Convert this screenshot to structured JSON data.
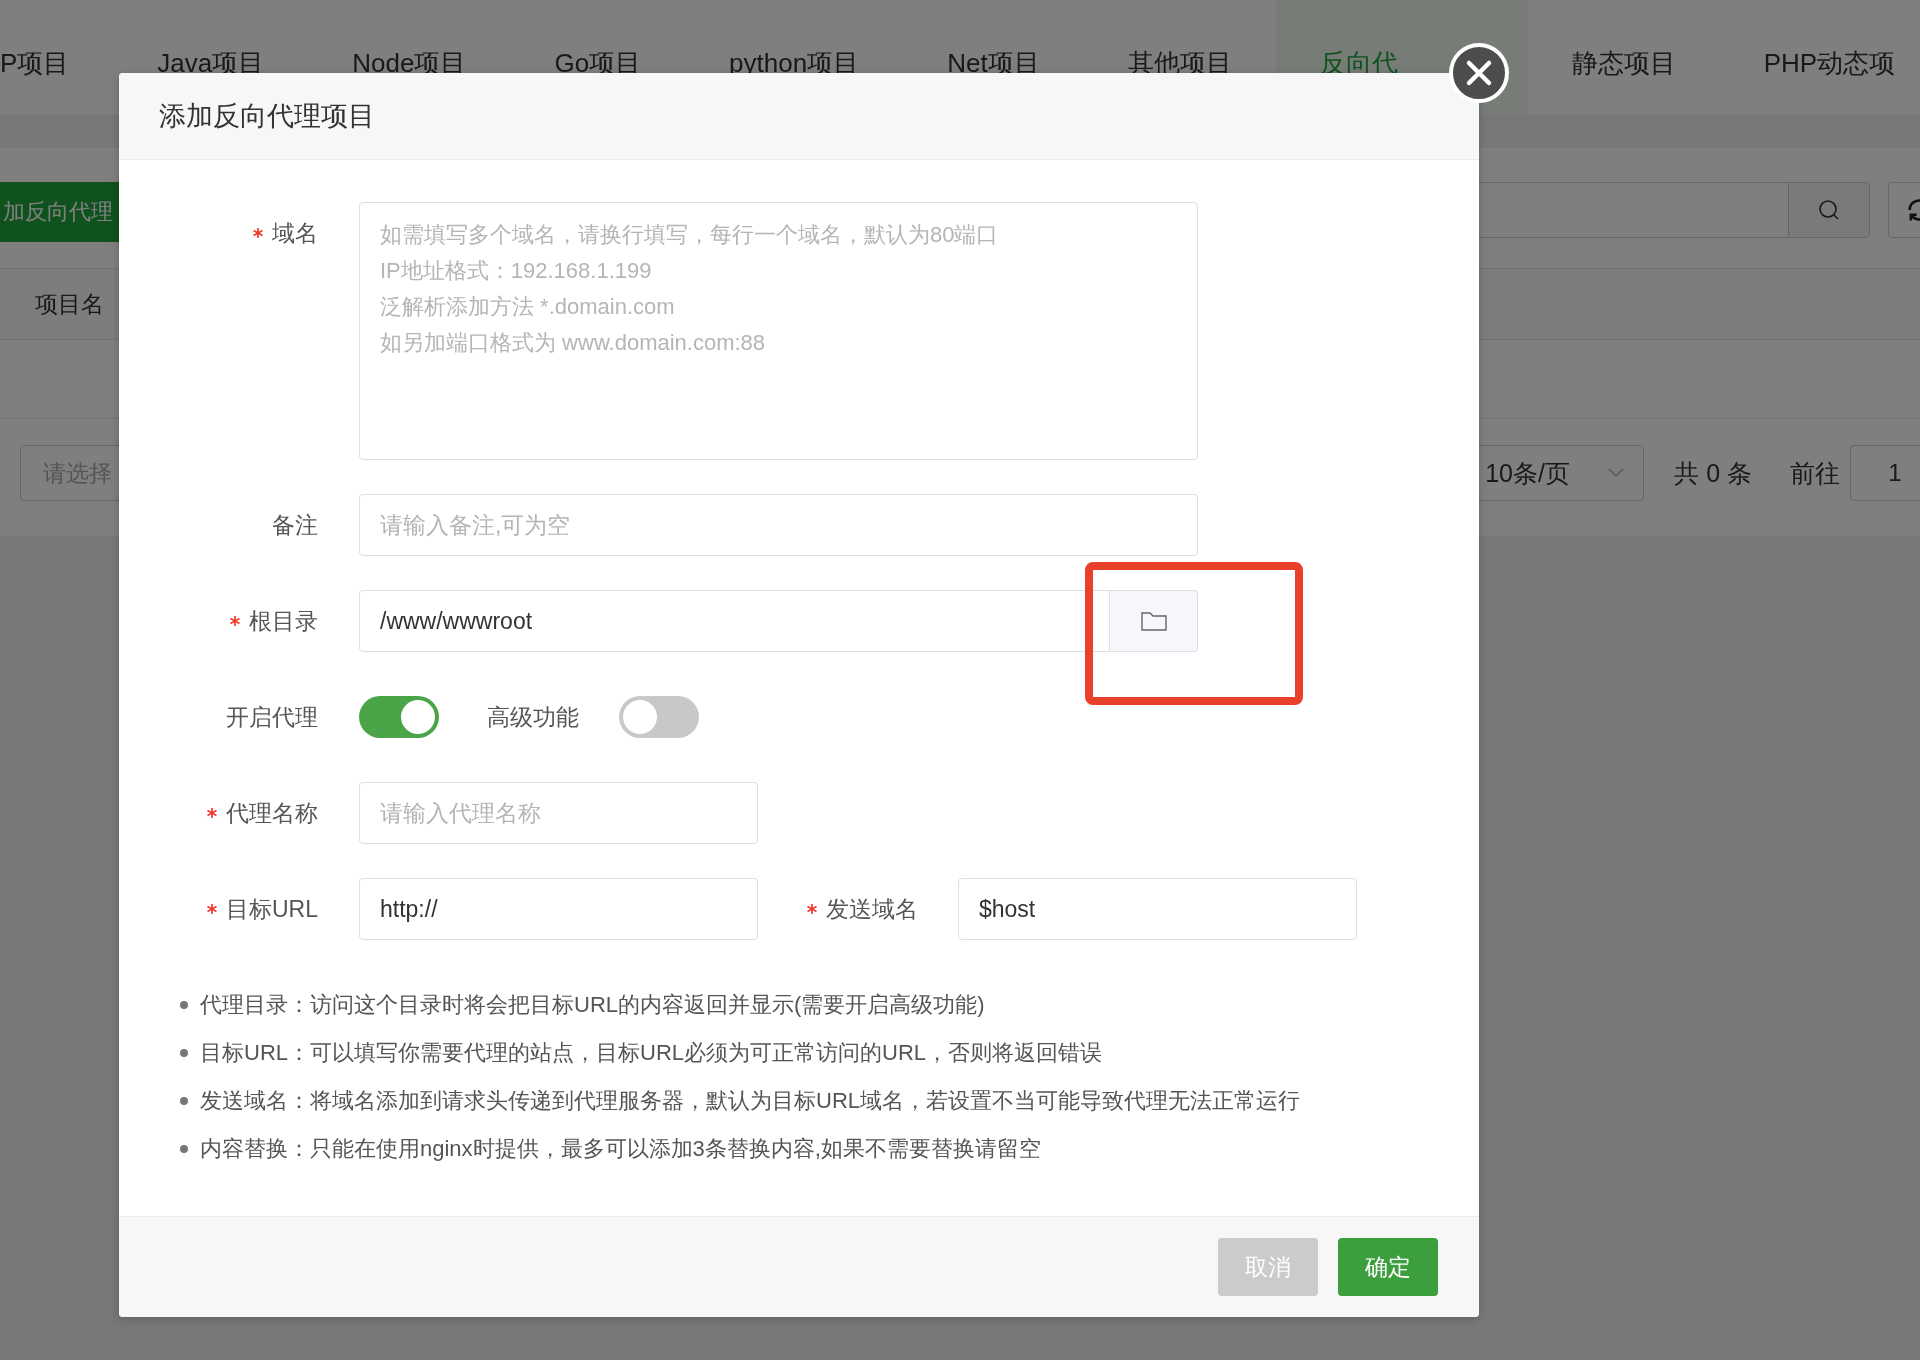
{
  "tabs": [
    {
      "label": "P项目",
      "selected": false
    },
    {
      "label": "Java项目",
      "selected": false
    },
    {
      "label": "Node项目",
      "selected": false
    },
    {
      "label": "Go项目",
      "selected": false
    },
    {
      "label": "python项目",
      "selected": false
    },
    {
      "label": "Net项目",
      "selected": false
    },
    {
      "label": "其他项目",
      "selected": false
    },
    {
      "label": "反向代",
      "selected": true
    },
    {
      "label": "静态项目",
      "selected": false
    },
    {
      "label": "PHP动态项",
      "selected": false
    }
  ],
  "toolbar": {
    "add_button": "加反向代理"
  },
  "table": {
    "columns": [
      "项目名"
    ]
  },
  "pagination": {
    "select_placeholder": "请选择",
    "page_size": "10条/页",
    "total": "共 0 条",
    "goto_label": "前往",
    "page_input": "1"
  },
  "dialog": {
    "title": "添加反向代理项目",
    "rows": [
      {
        "items": [
          {
            "kind": "textarea",
            "label": "域名",
            "required": true,
            "placeholder": "如需填写多个域名，请换行填写，每行一个域名，默认为80端口\nIP地址格式：192.168.1.199\n泛解析添加方法 *.domain.com\n如另加端口格式为 www.domain.com:88"
          }
        ]
      },
      {
        "items": [
          {
            "kind": "text",
            "label": "备注",
            "required": false,
            "placeholder": "请输入备注,可为空"
          }
        ]
      },
      {
        "items": [
          {
            "kind": "path",
            "label": "根目录",
            "required": true,
            "value": "/www/wwwroot"
          }
        ]
      },
      {
        "items": [
          {
            "kind": "switch",
            "label": "开启代理",
            "on": true
          },
          {
            "kind": "switch",
            "label": "高级功能",
            "on": false
          }
        ]
      },
      {
        "items": [
          {
            "kind": "short",
            "label": "代理名称",
            "required": true,
            "placeholder": "请输入代理名称"
          }
        ]
      },
      {
        "items": [
          {
            "kind": "short",
            "label": "目标URL",
            "required": true,
            "value": "http://"
          },
          {
            "kind": "short",
            "label": "发送域名",
            "required": true,
            "value": "$host"
          }
        ]
      }
    ],
    "notes": [
      "代理目录：访问这个目录时将会把目标URL的内容返回并显示(需要开启高级功能)",
      "目标URL：可以填写你需要代理的站点，目标URL必须为可正常访问的URL，否则将返回错误",
      "发送域名：将域名添加到请求头传递到代理服务器，默认为目标URL域名，若设置不当可能导致代理无法正常运行",
      "内容替换：只能在使用nginx时提供，最多可以添加3条替换内容,如果不需要替换请留空"
    ],
    "buttons": [
      {
        "label": "取消",
        "kind": "cancel"
      },
      {
        "label": "确定",
        "kind": "primary"
      }
    ]
  }
}
